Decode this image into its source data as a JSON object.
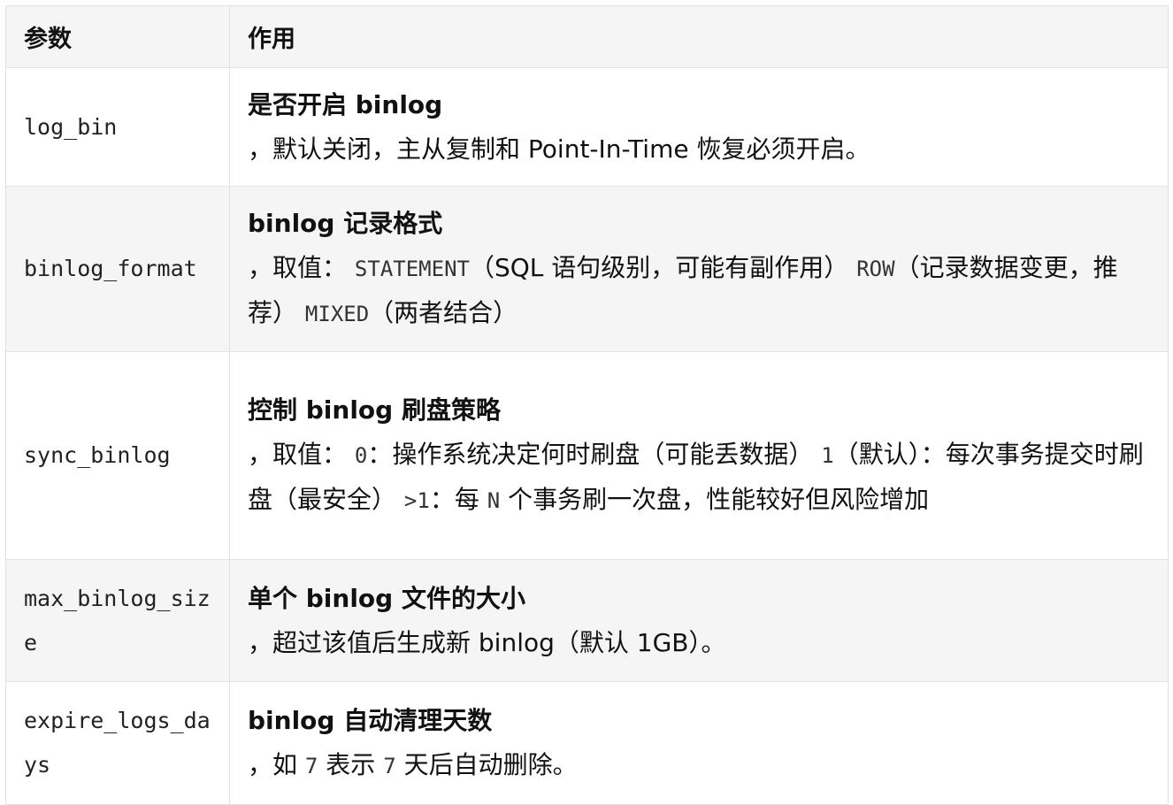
{
  "table": {
    "headers": {
      "param": "参数",
      "purpose": "作用"
    },
    "rows": [
      {
        "name": "log_bin",
        "title": "是否开启 binlog",
        "desc": "，默认关闭，主从复制和 Point-In-Time 恢复必须开启。"
      },
      {
        "name": "binlog_format",
        "title": "binlog 记录格式",
        "desc_prefix": "，取值：",
        "opt1_code": "STATEMENT",
        "opt1_text": "（SQL 语句级别，可能有副作用）",
        "opt2_code": "ROW",
        "opt2_text": "（记录数据变更，推荐）",
        "opt3_code": "MIXED",
        "opt3_text": "（两者结合）"
      },
      {
        "name": "sync_binlog",
        "title": "控制 binlog 刷盘策略",
        "desc_prefix": "，取值：",
        "opt1_code": "0",
        "opt1_text": "：操作系统决定何时刷盘（可能丢数据）",
        "opt2_code": "1",
        "opt2_text": "（默认）：每次事务提交时刷盘（最安全）",
        "opt3_code": ">1",
        "opt3_text": "：每",
        "opt3_n_code": "N",
        "opt3_tail": "个事务刷一次盘，性能较好但风险增加"
      },
      {
        "name": "max_binlog_size",
        "title": "单个 binlog 文件的大小",
        "desc": "，超过该值后生成新 binlog（默认 1GB）。"
      },
      {
        "name": "expire_logs_days",
        "title": "binlog 自动清理天数",
        "desc_prefix": "，如",
        "num1_code": "7",
        "desc_mid": "表示",
        "num2_code": "7",
        "desc_tail": "天后自动删除。"
      }
    ]
  }
}
